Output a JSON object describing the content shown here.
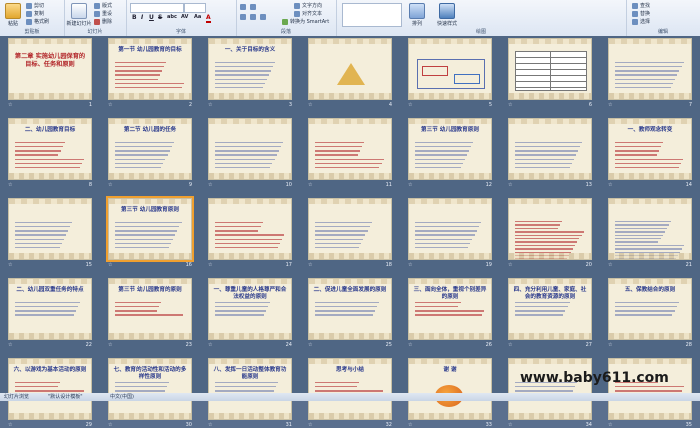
{
  "ribbon": {
    "clipboard": {
      "label": "剪贴板",
      "paste": "粘贴",
      "cut": "剪切",
      "copy": "复制",
      "format_painter": "格式刷"
    },
    "slides": {
      "label": "幻灯片",
      "new_slide": "新建幻灯片",
      "layout": "版式",
      "reset": "重设",
      "delete": "删除"
    },
    "font": {
      "label": "字体",
      "font_name": "",
      "font_size": "",
      "bold": "B",
      "italic": "I",
      "underline": "U",
      "strike": "S",
      "shadow": "abc",
      "spacing": "AV",
      "case": "Aa",
      "color": "A"
    },
    "paragraph": {
      "label": "段落",
      "text_direction": "文字方向",
      "align_text": "对齐文本",
      "smartart": "转换为 SmartArt"
    },
    "drawing": {
      "label": "绘图",
      "arrange": "排列",
      "quick_styles": "快速样式"
    },
    "editing": {
      "label": "编辑",
      "find": "查找",
      "replace": "替换",
      "select": "选择"
    }
  },
  "slides": [
    {
      "title": "第二章 实施幼儿园保育的目标、任务和原则"
    },
    {
      "title": "第一节 幼儿园教育的目标"
    },
    {
      "title": "一、关于目标的含义"
    },
    {
      "title": ""
    },
    {
      "title": ""
    },
    {
      "title": ""
    },
    {
      "title": ""
    },
    {
      "title": "二、幼儿园教育目标"
    },
    {
      "title": "第二节 幼儿园的任务"
    },
    {
      "title": ""
    },
    {
      "title": ""
    },
    {
      "title": "第三节 幼儿园教育原则"
    },
    {
      "title": ""
    },
    {
      "title": "一、教师观念转变"
    },
    {
      "title": ""
    },
    {
      "title": "第三节 幼儿园教育原则"
    },
    {
      "title": ""
    },
    {
      "title": ""
    },
    {
      "title": ""
    },
    {
      "title": ""
    },
    {
      "title": ""
    },
    {
      "title": "二、幼儿园双重任务的特点"
    },
    {
      "title": "第三节 幼儿园教育的原则"
    },
    {
      "title": "一、尊重儿童的人格尊严和合法权益的原则"
    },
    {
      "title": "二、促进儿童全面发展的原则"
    },
    {
      "title": "三、面向全体，重视个别差异的原则"
    },
    {
      "title": "四、充分利用儿童、家庭、社会的教育资源的原则"
    },
    {
      "title": "五、保教结合的原则"
    },
    {
      "title": "六、以游戏为基本活动的原则"
    },
    {
      "title": "七、教育的活动性和活动的多样性原则"
    },
    {
      "title": "八、发挥一日活动整体教育功能原则"
    },
    {
      "title": "思考与小结"
    },
    {
      "title": "谢 谢"
    },
    {
      "title": ""
    },
    {
      "title": ""
    }
  ],
  "slide_numbers": [
    "1",
    "2",
    "3",
    "4",
    "5",
    "6",
    "7",
    "8",
    "9",
    "10",
    "11",
    "12",
    "13",
    "14",
    "15",
    "16",
    "17",
    "18",
    "19",
    "20",
    "21",
    "22",
    "23",
    "24",
    "25",
    "26",
    "27",
    "28",
    "29",
    "30",
    "31",
    "32",
    "33",
    "34",
    "35"
  ],
  "thanks_text": "谢 谢",
  "status": {
    "view": "幻灯片浏览",
    "theme": "\"默认设计模板\"",
    "language": "中文(中国)"
  },
  "watermark": "www.baby611.com"
}
